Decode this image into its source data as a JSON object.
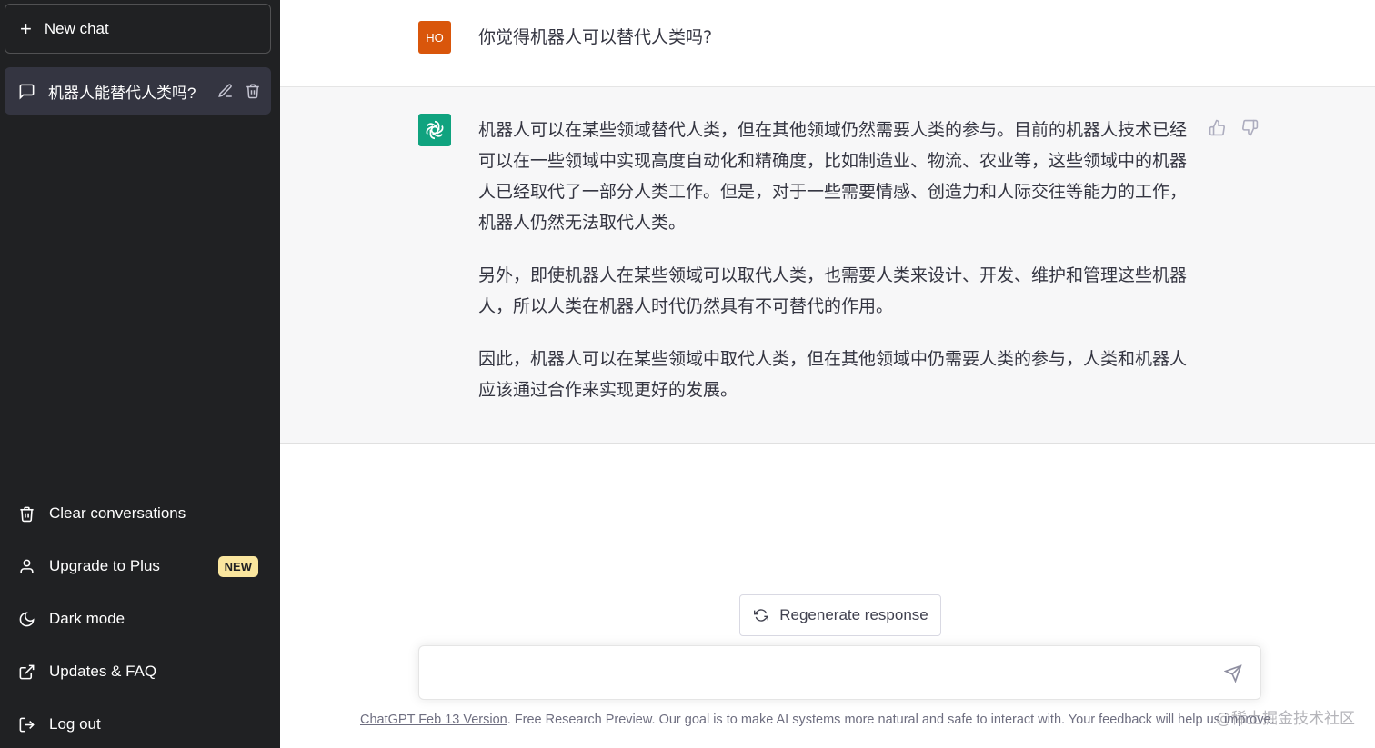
{
  "sidebar": {
    "new_chat_label": "New chat",
    "conversations": [
      {
        "title": "机器人能替代人类吗?"
      }
    ],
    "menu": {
      "clear": "Clear conversations",
      "upgrade": "Upgrade to Plus",
      "upgrade_badge": "NEW",
      "dark_mode": "Dark mode",
      "updates": "Updates & FAQ",
      "logout": "Log out"
    }
  },
  "chat": {
    "user_avatar": "HO",
    "user_message": "你觉得机器人可以替代人类吗?",
    "assistant_paragraphs": [
      "机器人可以在某些领域替代人类，但在其他领域仍然需要人类的参与。目前的机器人技术已经可以在一些领域中实现高度自动化和精确度，比如制造业、物流、农业等，这些领域中的机器人已经取代了一部分人类工作。但是，对于一些需要情感、创造力和人际交往等能力的工作，机器人仍然无法取代人类。",
      "另外，即使机器人在某些领域可以取代人类，也需要人类来设计、开发、维护和管理这些机器人，所以人类在机器人时代仍然具有不可替代的作用。",
      "因此，机器人可以在某些领域中取代人类，但在其他领域中仍需要人类的参与，人类和机器人应该通过合作来实现更好的发展。"
    ]
  },
  "composer": {
    "regenerate_label": "Regenerate response",
    "input_value": "",
    "input_placeholder": ""
  },
  "footer": {
    "version_link": "ChatGPT Feb 13 Version",
    "text": ". Free Research Preview. Our goal is to make AI systems more natural and safe to interact with. Your feedback will help us improve."
  },
  "watermark": "@稀土掘金技术社区",
  "colors": {
    "sidebar_bg": "#202123",
    "selected_conv_bg": "#343541",
    "user_avatar_bg": "#d9560b",
    "assistant_avatar_bg": "#10a37f",
    "badge_bg": "#fae69e",
    "assistant_row_bg": "#f7f7f8"
  }
}
